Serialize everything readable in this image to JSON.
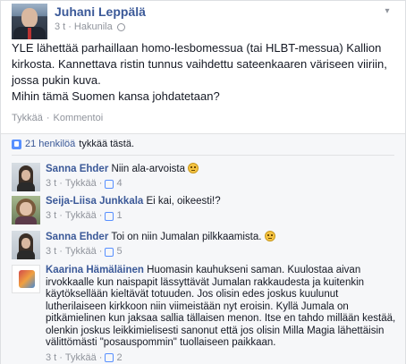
{
  "post": {
    "author": "Juhani Leppälä",
    "time": "3 t",
    "location": "Hakunila",
    "lines": [
      "YLE lähettää parhaillaan homo-lesbomessua (tai HLBT-messua) Kallion",
      "kirkosta. Kannettava ristin tunnus vaihdettu sateenkaaren väriseen viiriin,",
      "jossa pukin kuva.",
      "Mihin tämä Suomen kansa johdatetaan?"
    ],
    "like_label": "Tykkää",
    "comment_label": "Kommentoi",
    "separator": "·"
  },
  "likes": {
    "count_text": "21 henkilöä",
    "rest_text": "tykkää tästä."
  },
  "comments": [
    {
      "name": "Sanna Ehder",
      "text": "Niin ala-arvoista",
      "time": "3 t",
      "like_label": "Tykkää",
      "likes": "4"
    },
    {
      "name": "Seija-Liisa Junkkala",
      "text": "Ei kai, oikeesti!?",
      "time": "3 t",
      "like_label": "Tykkää",
      "likes": "1"
    },
    {
      "name": "Sanna Ehder",
      "text": "Toi on niin Jumalan pilkkaamista.",
      "time": "3 t",
      "like_label": "Tykkää",
      "likes": "5"
    },
    {
      "name": "Kaarina Hämäläinen",
      "text": "Huomasin kauhukseni saman. Kuulostaa aivan irvokkaalle kun naispapit lässyttävät Jumalan rakkaudesta ja kuitenkin käytöksellään kieltävät totuuden. Jos olisin edes joskus kuulunut lutherilaiseen kirkkoon niin viimeistään nyt eroisin. Kyllä Jumala on pitkämielinen kun jaksaa sallia tällaisen menon. Itse en tahdo millään kestää, olenkin joskus leikkimielisesti sanonut että jos olisin Milla Magia lähettäisin välittömästi \"posauspommin\" tuollaiseen paikkaan.",
      "time": "3 t",
      "like_label": "Tykkää",
      "likes": "2"
    }
  ],
  "colors": {
    "link": "#3b5998",
    "meta": "#90949c",
    "feedback_bg": "#f6f7f9"
  },
  "icons": [
    "globe-icon",
    "chevron-down-icon",
    "thumb-up-icon",
    "smiley-icon"
  ]
}
